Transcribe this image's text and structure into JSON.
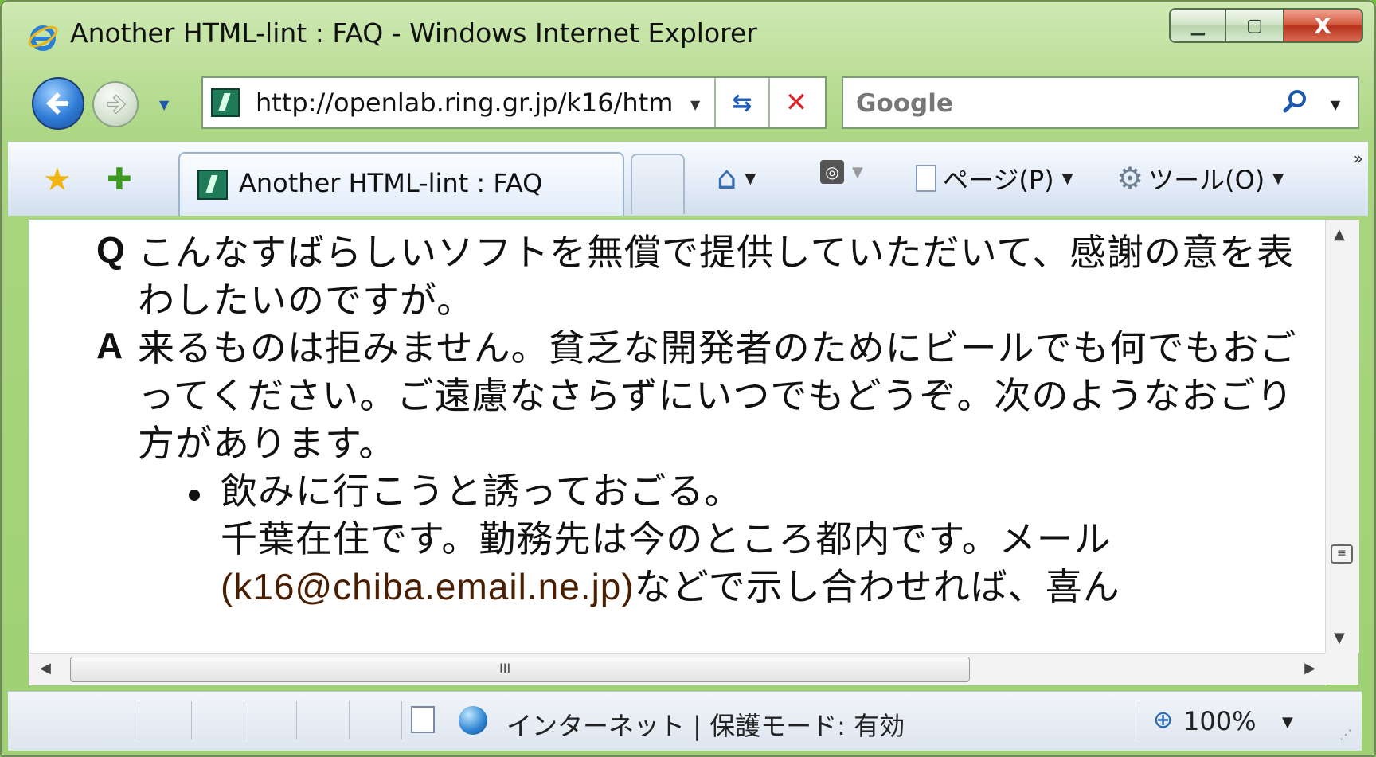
{
  "window": {
    "title": "Another HTML-lint : FAQ - Windows Internet Explorer",
    "caption_minimize": "▁",
    "caption_maximize": "▢",
    "caption_close": "X"
  },
  "navigation": {
    "back_glyph": "←",
    "forward_glyph": "→",
    "url": "http://openlab.ring.gr.jp/k16/htm",
    "refresh_glyph": "⇆",
    "stop_glyph": "✕",
    "search_placeholder": "Google"
  },
  "commandbar": {
    "tab_title": "Another HTML-lint : FAQ",
    "page_menu": "ページ(P)",
    "tools_menu": "ツール(O)",
    "chevron": "»"
  },
  "content": {
    "q_label": "Q",
    "q_text": "こんなすばらしいソフトを無償で提供していただいて、感謝の意を表わしたいのですが。",
    "a_label": "A",
    "a_text": "来るものは拒みません。貧乏な開発者のためにビールでも何でもおごってください。ご遠慮なさらずにいつでもどうぞ。次のようなおごり方があります。",
    "bullet_line1": "飲みに行こうと誘っておごる。",
    "bullet_line2": "千葉在住です。勤務先は今のところ都内です。メール",
    "email": "(k16@chiba.email.ne.jp)",
    "bullet_line3_rest": "などで示し合わせれば、喜ん"
  },
  "scrollbar": {
    "hthumb_grip": "III",
    "vgrip": "≡"
  },
  "statusbar": {
    "zone": "インターネット | 保護モード: 有効",
    "zoom": "100%"
  },
  "icons": [
    "ie-icon",
    "back-icon",
    "forward-icon",
    "page-favicon",
    "refresh-icon",
    "stop-icon",
    "search-icon",
    "favorites-star-icon",
    "add-favorites-icon",
    "home-icon",
    "feed-icon",
    "page-icon",
    "gear-icon",
    "popup-blocker-icon",
    "globe-icon",
    "zoom-icon"
  ]
}
